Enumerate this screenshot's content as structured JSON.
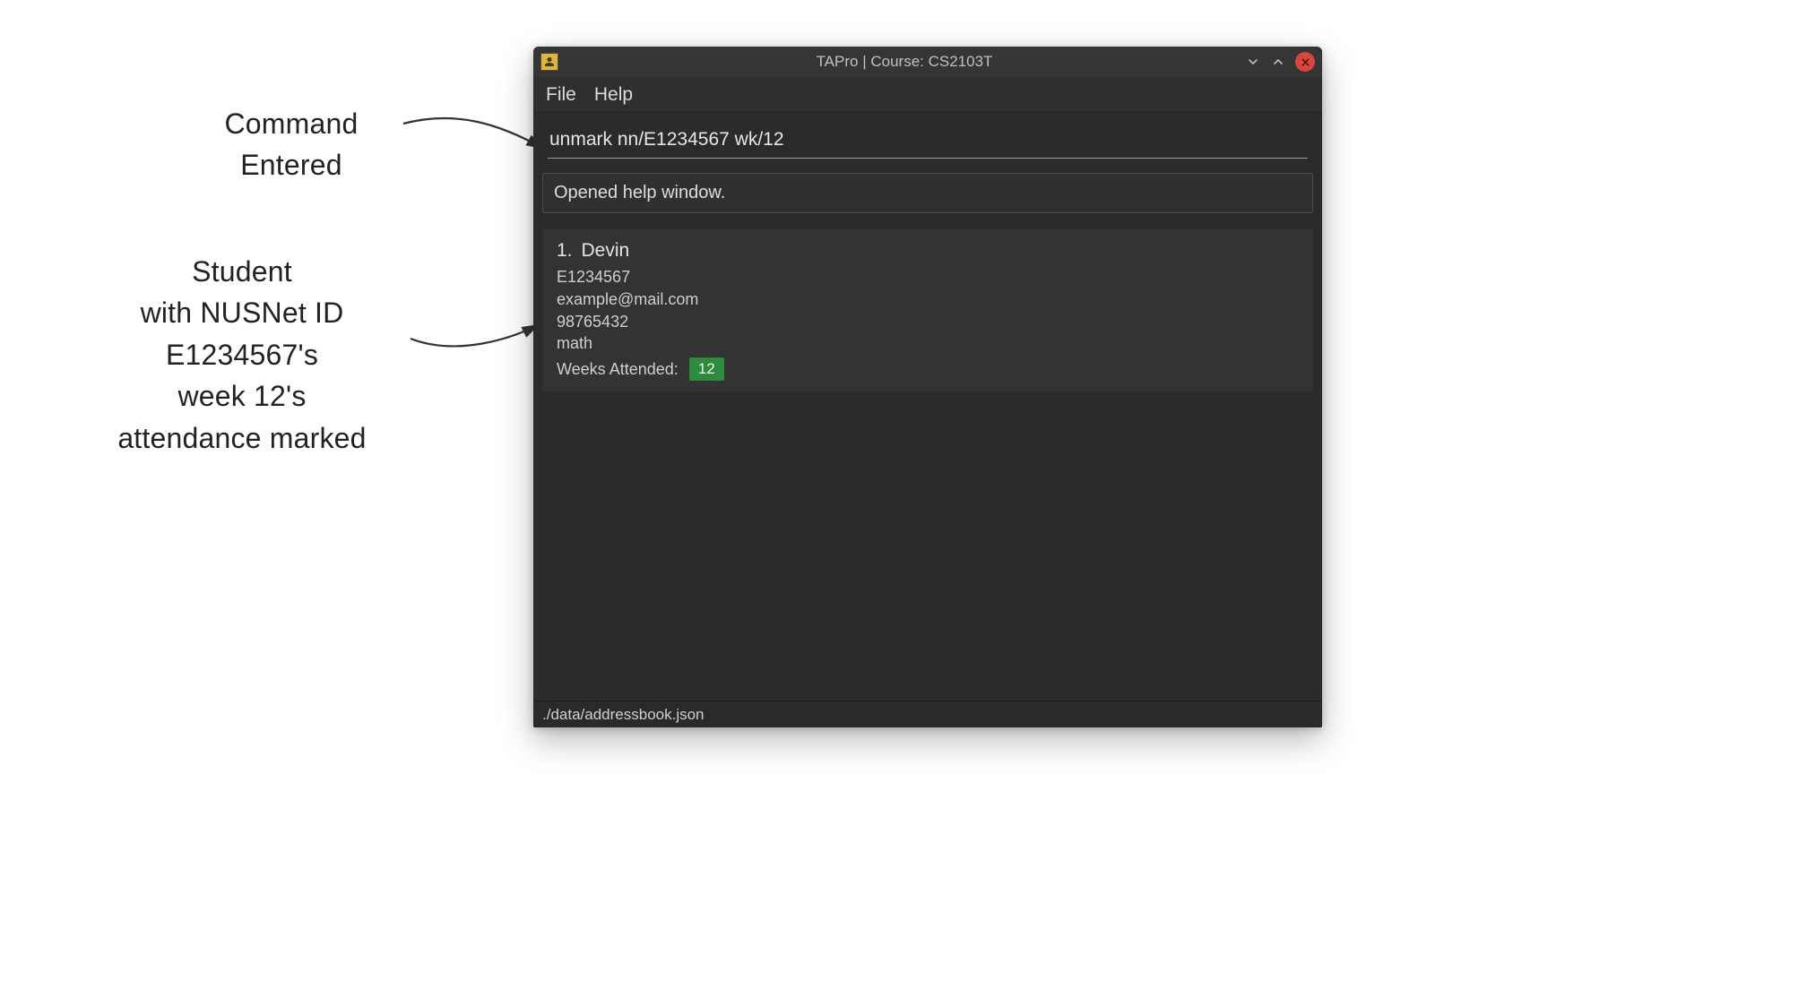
{
  "annotations": {
    "command_entered": "Command\nEntered",
    "student_desc": "Student\nwith NUSNet ID\nE1234567's\nweek 12's\nattendance marked"
  },
  "titlebar": {
    "title": "TAPro | Course: CS2103T"
  },
  "menubar": {
    "file": "File",
    "help": "Help"
  },
  "command_input": {
    "value": "unmark nn/E1234567 wk/12"
  },
  "result": {
    "text": "Opened help window."
  },
  "students": [
    {
      "index": "1.",
      "name": "Devin",
      "nusnet": "E1234567",
      "email": "example@mail.com",
      "phone": "98765432",
      "module": "math",
      "weeks_label": "Weeks Attended:",
      "weeks_attended": [
        "12"
      ]
    }
  ],
  "statusbar": {
    "path": "./data/addressbook.json"
  },
  "colors": {
    "badge_bg": "#2e8b3d",
    "close_bg": "#d9463d",
    "window_bg": "#2b2b2b"
  }
}
